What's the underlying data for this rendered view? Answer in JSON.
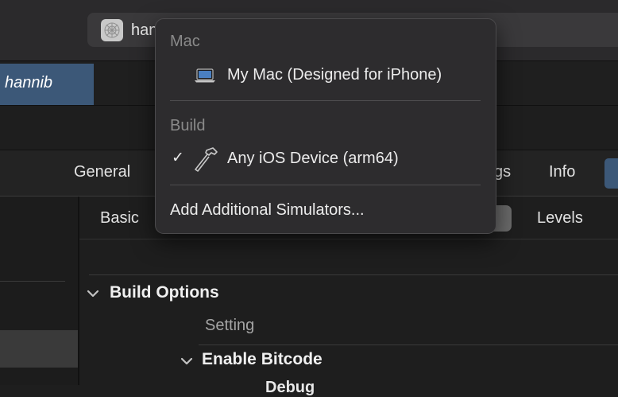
{
  "toolbar": {
    "scheme_name": "hannib"
  },
  "navigator": {
    "selected_tab": "hannib"
  },
  "editor_tabs": {
    "general": "General",
    "build_settings_partial": "gs",
    "info": "Info"
  },
  "filter": {
    "basic": "Basic",
    "levels": "Levels"
  },
  "settings": {
    "section_title": "Build Options",
    "column_header": "Setting",
    "row_title": "Enable Bitcode",
    "sub_row": "Debug"
  },
  "destination_menu": {
    "mac_header": "Mac",
    "my_mac_label": "My Mac (Designed for iPhone)",
    "build_header": "Build",
    "any_ios_label": "Any iOS Device (arm64)",
    "checkmark": "✓",
    "add_simulators_label": "Add Additional Simulators..."
  },
  "icons": {
    "app": "app-icon",
    "laptop": "laptop-icon",
    "hammer": "hammer-icon",
    "disclosure": "chevron-down-icon"
  },
  "colors": {
    "selection_blue": "#3c5878",
    "menu_background": "#2d2c2e"
  }
}
